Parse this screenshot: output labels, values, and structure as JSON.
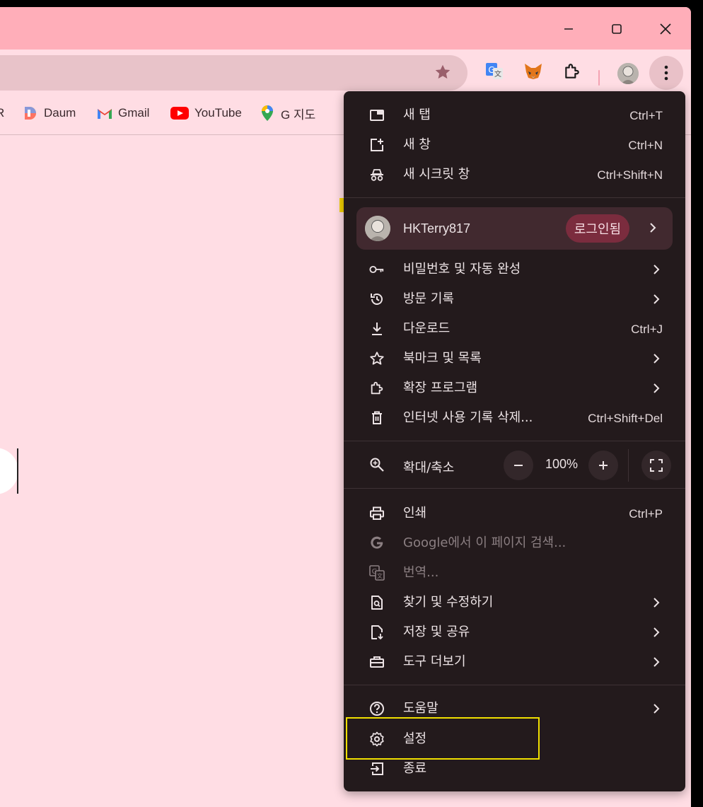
{
  "bookmarks": [
    {
      "label": "R"
    },
    {
      "label": "Daum"
    },
    {
      "label": "Gmail"
    },
    {
      "label": "YouTube"
    },
    {
      "label": "G 지도"
    }
  ],
  "menu": {
    "new_tab": {
      "label": "새 탭",
      "shortcut": "Ctrl+T"
    },
    "new_window": {
      "label": "새 창",
      "shortcut": "Ctrl+N"
    },
    "incognito": {
      "label": "새 시크릿 창",
      "shortcut": "Ctrl+Shift+N"
    },
    "profile": {
      "name": "HKTerry817",
      "badge": "로그인됨"
    },
    "passwords": {
      "label": "비밀번호 및 자동 완성"
    },
    "history": {
      "label": "방문 기록"
    },
    "downloads": {
      "label": "다운로드",
      "shortcut": "Ctrl+J"
    },
    "bookmarks": {
      "label": "북마크 및 목록"
    },
    "extensions": {
      "label": "확장 프로그램"
    },
    "clear_data": {
      "label": "인터넷 사용 기록 삭제...",
      "shortcut": "Ctrl+Shift+Del"
    },
    "zoom": {
      "label": "확대/축소",
      "value": "100%"
    },
    "print": {
      "label": "인쇄",
      "shortcut": "Ctrl+P"
    },
    "google_search": {
      "label": "Google에서 이 페이지 검색..."
    },
    "translate": {
      "label": "번역..."
    },
    "find_edit": {
      "label": "찾기 및 수정하기"
    },
    "save_share": {
      "label": "저장 및 공유"
    },
    "more_tools": {
      "label": "도구 더보기"
    },
    "help": {
      "label": "도움말"
    },
    "settings": {
      "label": "설정"
    },
    "exit": {
      "label": "종료"
    }
  },
  "colors": {
    "titlebar": "#ffaeb9",
    "page_bg": "#ffdde4",
    "menu_bg": "#231a1c",
    "badge_bg": "#7b2c3e",
    "highlight": "#f0e000"
  }
}
